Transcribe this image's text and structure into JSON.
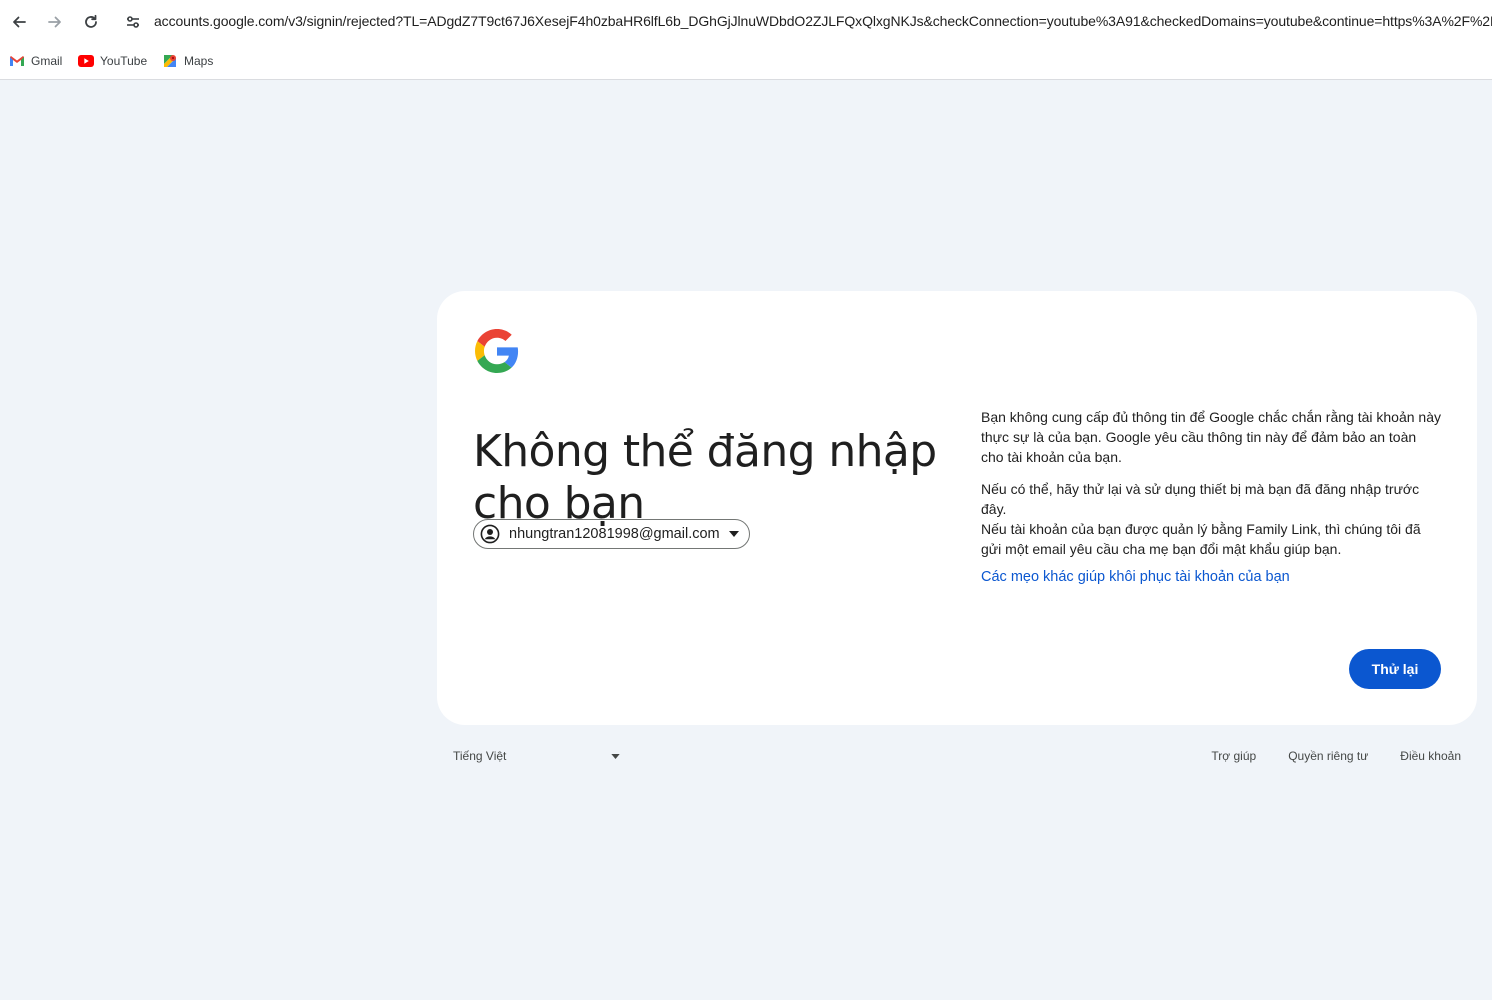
{
  "browser": {
    "url": "accounts.google.com/v3/signin/rejected?TL=ADgdZ7T9ct67J6XesejF4h0zbaHR6lfL6b_DGhGjJlnuWDbdO2ZJLFQxQlxgNKJs&checkConnection=youtube%3A91&checkedDomains=youtube&continue=https%3A%2F%2F",
    "bookmarks": [
      {
        "label": "Gmail",
        "icon": "gmail-icon"
      },
      {
        "label": "YouTube",
        "icon": "youtube-icon"
      },
      {
        "label": "Maps",
        "icon": "maps-icon"
      }
    ]
  },
  "card": {
    "headline": "Không thể đăng nhập cho bạn",
    "account_email": "nhungtran12081998@gmail.com",
    "paragraph_1": "Bạn không cung cấp đủ thông tin để Google chắc chắn rằng tài khoản này thực sự là của bạn. Google yêu cầu thông tin này để đảm bảo an toàn cho tài khoản của bạn.",
    "paragraph_2": "Nếu có thể, hãy thử lại và sử dụng thiết bị mà bạn đã đăng nhập trước đây.",
    "paragraph_3": "Nếu tài khoản của bạn được quản lý bằng Family Link, thì chúng tôi đã gửi một email yêu cầu cha mẹ bạn đổi mật khẩu giúp bạn.",
    "help_link": "Các mẹo khác giúp khôi phục tài khoản của bạn",
    "retry_button": "Thử lại"
  },
  "footer": {
    "language": "Tiếng Việt",
    "help": "Trợ giúp",
    "privacy": "Quyền riêng tư",
    "terms": "Điều khoản"
  },
  "colors": {
    "background": "#f0f4f9",
    "primary": "#0b57d0",
    "card": "#ffffff"
  }
}
